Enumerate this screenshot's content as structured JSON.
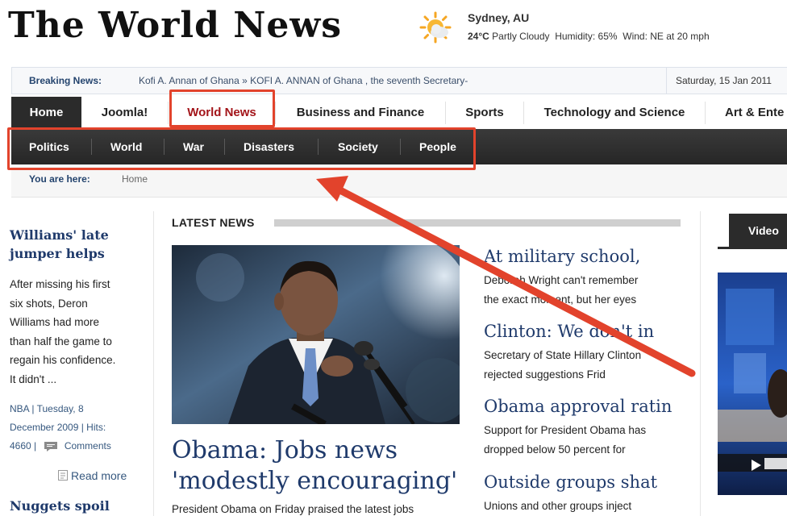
{
  "site": {
    "logo": "The World News"
  },
  "weather": {
    "city": "Sydney, AU",
    "temp": "24°C",
    "condition": "Partly Cloudy",
    "humidity": "Humidity: 65%",
    "wind": "Wind: NE at 20 mph",
    "icon": "partly-cloudy-icon"
  },
  "breaking": {
    "label": "Breaking News:",
    "text": "Kofi A. Annan of Ghana   »   KOFI A. ANNAN of Ghana , the seventh Secretary-",
    "date": "Saturday, 15 Jan 2011"
  },
  "nav": {
    "home": "Home",
    "joomla": "Joomla!",
    "world_news": "World News",
    "business": "Business and Finance",
    "sports": "Sports",
    "tech": "Technology and Science",
    "art": "Art & Ente"
  },
  "subnav": [
    "Politics",
    "World",
    "War",
    "Disasters",
    "Society",
    "People"
  ],
  "breadcrumb": {
    "label": "You are here:",
    "home": "Home"
  },
  "left": {
    "story1": {
      "title1": "Williams' late",
      "title2": "jumper helps",
      "body": [
        "After missing his first",
        "six shots, Deron",
        "Williams had more",
        "than half the game to",
        "regain his confidence.",
        "It didn't ..."
      ],
      "meta1": "NBA | Tuesday, 8",
      "meta2": "December 2009 | Hits:",
      "meta3": "4660 |",
      "comments": "Comments",
      "readmore": "Read more"
    },
    "story2": {
      "title": "Nuggets spoil"
    }
  },
  "center": {
    "section_title": "LATEST NEWS",
    "headline1": "Obama: Jobs news",
    "headline2": "'modestly encouraging'",
    "lead": "President Obama on Friday praised the latest jobs"
  },
  "stories": [
    {
      "title": "At military school,",
      "line1": "Deborah Wright can't remember",
      "line2": "the exact moment, but her eyes"
    },
    {
      "title": "Clinton: We don't in",
      "line1": "Secretary of State Hillary Clinton",
      "line2": "rejected suggestions Frid"
    },
    {
      "title": "Obama approval ratin",
      "line1": "Support for President Obama has",
      "line2": "dropped below 50 percent for"
    },
    {
      "title": "Outside groups shat",
      "line1": "Unions and other groups inject",
      "line2": ""
    }
  ],
  "right": {
    "video_tab": "Video"
  },
  "colors": {
    "highlight": "#e2432c",
    "link": "#1f3a6b",
    "nav_dark": "#2b2b2b"
  }
}
